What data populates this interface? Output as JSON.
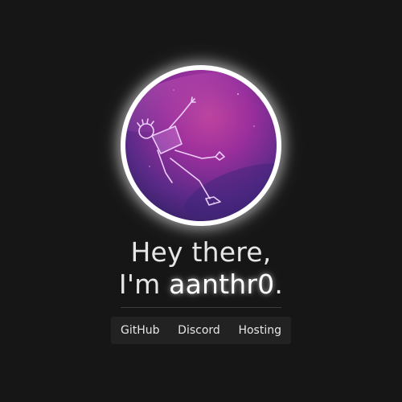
{
  "profile": {
    "avatar_icon": "avatar-floating-figure-in-purple-space",
    "greeting_line1": "Hey there,",
    "greeting_prefix": "I'm ",
    "name": "aanthr0",
    "greeting_suffix": "."
  },
  "links": [
    {
      "label": "GitHub"
    },
    {
      "label": "Discord"
    },
    {
      "label": "Hosting"
    }
  ],
  "colors": {
    "background": "#161616",
    "text": "#e6e6e6",
    "avatar_ring": "#ffffff",
    "link_bar": "#222222",
    "avatar_purple": "#9b2f9c"
  }
}
